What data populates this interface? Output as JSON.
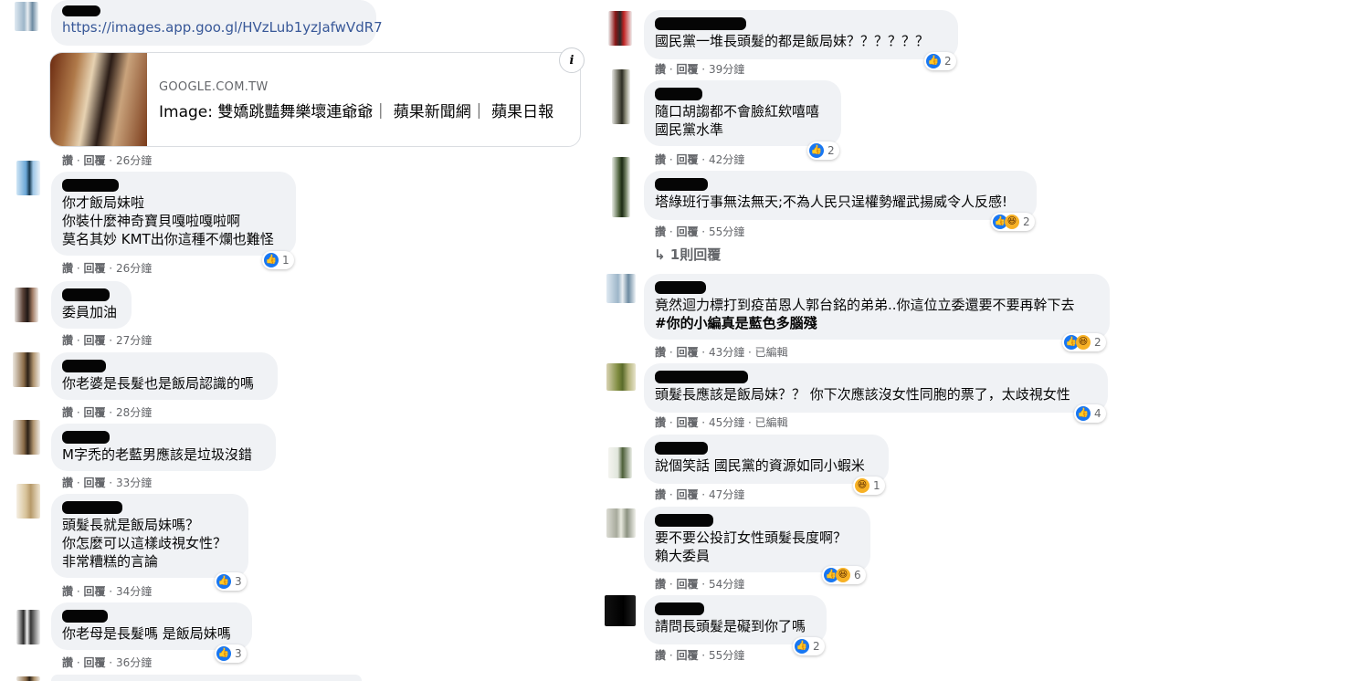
{
  "link_comment": {
    "url_text": "https://images.app.goo.gl/HVzLub1yzJafwVdR7",
    "preview_domain": "GOOGLE.COM.TW",
    "preview_title": "Image: 雙嬌跳豔舞樂壞連爺爺｜ 蘋果新聞網｜ 蘋果日報",
    "info_glyph": "i",
    "meta": {
      "like": "讚",
      "reply": "回覆",
      "time": "26分鐘"
    }
  },
  "left_comments": [
    {
      "lines": [
        "你才飯局妹啦",
        "你裝什麼神奇寶貝嘎啦嘎啦啊",
        "莫名其妙 KMT出你這種不爛也難怪"
      ],
      "meta_time": "26分鐘",
      "reaction_count": "1"
    },
    {
      "lines": [
        "委員加油"
      ],
      "meta_time": "27分鐘",
      "reaction_count": ""
    },
    {
      "lines": [
        "你老婆是長髮也是飯局認識的嗎"
      ],
      "meta_time": "28分鐘",
      "reaction_count": ""
    },
    {
      "lines": [
        "M字禿的老藍男應該是垃圾沒錯"
      ],
      "meta_time": "33分鐘",
      "reaction_count": ""
    },
    {
      "lines": [
        "頭髮長就是飯局妹嗎？",
        "你怎麼可以這樣歧視女性？",
        "非常糟糕的言論"
      ],
      "meta_time": "34分鐘",
      "reaction_count": "3"
    },
    {
      "lines": [
        "你老母是長髮嗎 是飯局妹嗎"
      ],
      "meta_time": "36分鐘",
      "reaction_count": "3"
    }
  ],
  "right_comments": [
    {
      "lines": [
        "國民黨一堆長頭髮的都是飯局妹？？？？？？"
      ],
      "meta_time": "39分鐘",
      "meta_extra": "",
      "reaction_count": "2"
    },
    {
      "lines": [
        "隨口胡謅都不會臉紅欸嘻嘻",
        "國民黨水準"
      ],
      "meta_time": "42分鐘",
      "meta_extra": "",
      "reaction_count": "2"
    },
    {
      "lines": [
        "塔綠班行事無法無天;不為人民只逞權勢耀武揚威令人反感!"
      ],
      "meta_time": "55分鐘",
      "meta_extra": "",
      "reaction_count": "2"
    },
    {
      "lines": [
        "竟然迴力標打到疫苗恩人郭台銘的弟弟..你這位立委還要不要再幹下去",
        "#你的小編真是藍色多腦殘"
      ],
      "meta_time": "43分鐘",
      "meta_extra": "已編輯",
      "reaction_count": "2"
    },
    {
      "lines": [
        "頭髮長應該是飯局妹？？ 你下次應該沒女性同胞的票了，太歧視女性"
      ],
      "meta_time": "45分鐘",
      "meta_extra": "已編輯",
      "reaction_count": "4"
    },
    {
      "lines": [
        "說個笑話 國民黨的資源如同小蝦米"
      ],
      "meta_time": "47分鐘",
      "meta_extra": "",
      "reaction_count": "1"
    },
    {
      "lines": [
        "要不要公投訂女性頭髮長度啊？",
        "賴大委員"
      ],
      "meta_time": "54分鐘",
      "meta_extra": "",
      "reaction_count": "6"
    },
    {
      "lines": [
        "請問長頭髮是礙到你了嗎"
      ],
      "meta_time": "55分鐘",
      "meta_extra": "",
      "reaction_count": "2"
    }
  ],
  "replies_link": "1則回覆",
  "labels": {
    "like": "讚",
    "reply": "回覆",
    "dot": " · ",
    "edited": "已編輯"
  },
  "colors": {
    "like_blue": "#1877f2",
    "haha_yellow": "#f7b125",
    "bubble_bg": "#f0f2f5",
    "meta_gray": "#65676b"
  }
}
